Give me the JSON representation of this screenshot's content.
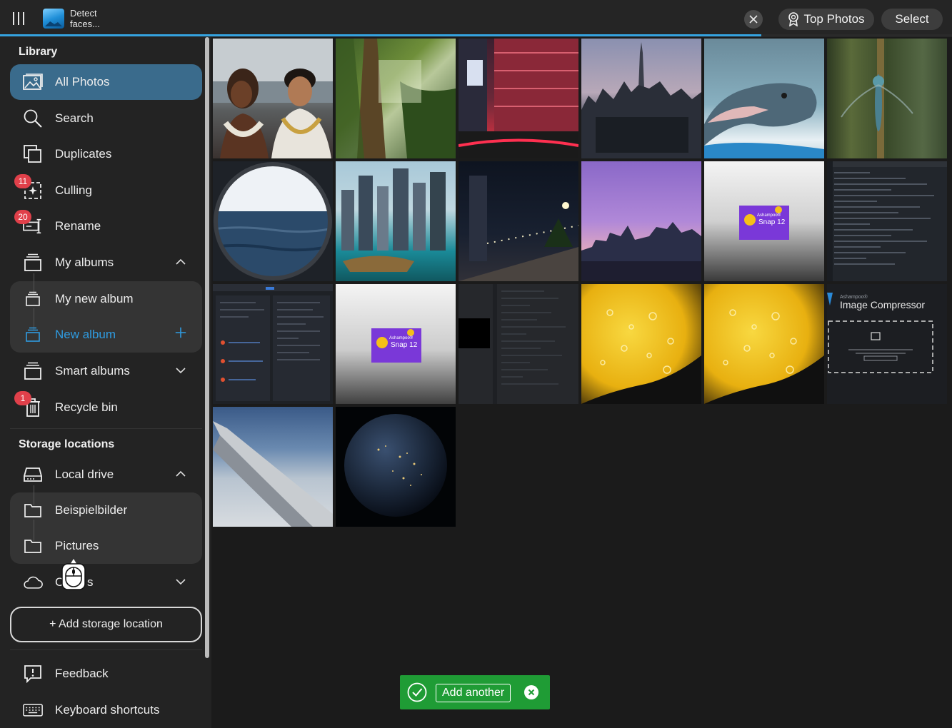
{
  "topbar": {
    "status_text": "Detect faces...",
    "progress": 0.8,
    "top_photos_label": "Top Photos",
    "select_label": "Select",
    "accent_color": "#35a3e0"
  },
  "sidebar": {
    "library_title": "Library",
    "items": [
      {
        "label": "All Photos",
        "icon": "image-icon",
        "active": true
      },
      {
        "label": "Search",
        "icon": "search-icon"
      },
      {
        "label": "Duplicates",
        "icon": "duplicates-icon"
      },
      {
        "label": "Culling",
        "icon": "culling-icon",
        "badge": "11"
      },
      {
        "label": "Rename",
        "icon": "rename-icon",
        "badge": "20"
      },
      {
        "label": "My albums",
        "icon": "album-icon",
        "expanded": true
      },
      {
        "label": "My new album",
        "icon": "album-icon"
      },
      {
        "label": "New album",
        "icon": "album-icon",
        "accent": true
      },
      {
        "label": "Smart albums",
        "icon": "album-icon",
        "expanded": false
      },
      {
        "label": "Recycle bin",
        "icon": "trash-icon",
        "badge": "1"
      }
    ],
    "storage_title": "Storage locations",
    "storage_items": [
      {
        "label": "Local drive",
        "icon": "drive-icon",
        "expanded": true
      },
      {
        "label": "Beispielbilder",
        "icon": "folder-icon"
      },
      {
        "label": "Pictures",
        "icon": "folder-icon"
      },
      {
        "label": "Cl",
        "label_end": "s",
        "icon": "cloud-icon",
        "expanded": false
      }
    ],
    "add_storage_label": "+ Add storage location",
    "footer_items": [
      {
        "label": "Feedback",
        "icon": "feedback-icon"
      },
      {
        "label": "Keyboard shortcuts",
        "icon": "keyboard-icon"
      }
    ]
  },
  "grid": {
    "tiles": [
      {
        "name": "couple-beach-photo"
      },
      {
        "name": "forest-photo"
      },
      {
        "name": "times-square-photo"
      },
      {
        "name": "city-skyline-photo"
      },
      {
        "name": "dolphin-photo"
      },
      {
        "name": "dragonfly-photo"
      },
      {
        "name": "porthole-sea-photo"
      },
      {
        "name": "dubai-marina-photo"
      },
      {
        "name": "night-promenade-photo"
      },
      {
        "name": "purple-skyline-photo"
      },
      {
        "name": "snap-12-screenshot",
        "logo_small": "Ashampoo®",
        "logo_text": "Snap 12"
      },
      {
        "name": "code-editor-screenshot"
      },
      {
        "name": "app-screenshot-dark"
      },
      {
        "name": "snap-12-screenshot-2",
        "logo_small": "Ashampoo®",
        "logo_text": "Snap 12"
      },
      {
        "name": "dark-code-screenshot"
      },
      {
        "name": "lemon-macro-photo"
      },
      {
        "name": "lemon-macro-photo-2"
      },
      {
        "name": "image-compressor-screenshot",
        "brand": "Ashampoo®",
        "title": "Image Compressor"
      },
      {
        "name": "airplane-wing-photo"
      },
      {
        "name": "earth-night-photo"
      }
    ]
  },
  "toast": {
    "add_another_label": "Add another",
    "color": "#1f9c35"
  }
}
